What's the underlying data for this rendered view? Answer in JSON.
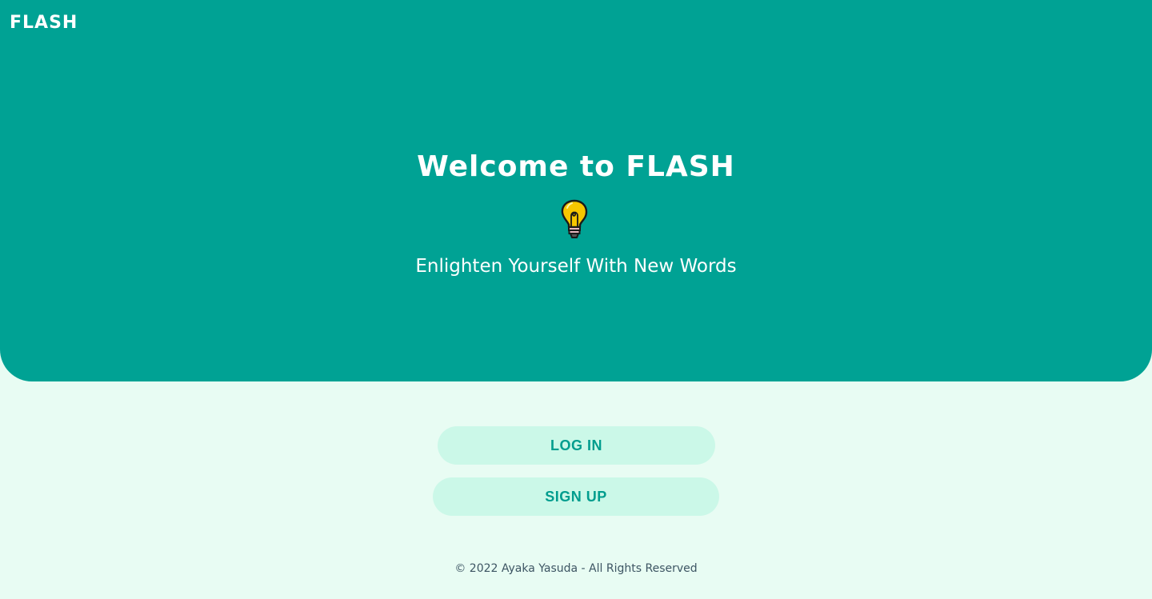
{
  "header": {
    "logo": "FLASH"
  },
  "hero": {
    "title": "Welcome to FLASH",
    "icon": "lightbulb-icon",
    "subtitle": "Enlighten Yourself With New Words",
    "background_color": "#00a294"
  },
  "actions": {
    "login_label": "LOG IN",
    "signup_label": "SIGN UP",
    "button_color": "#cbf8e8",
    "button_text_color": "#009d8e"
  },
  "footer": {
    "copyright": "© 2022 Ayaka Yasuda - All Rights Reserved"
  },
  "page": {
    "background_color": "#e8fcf3"
  }
}
